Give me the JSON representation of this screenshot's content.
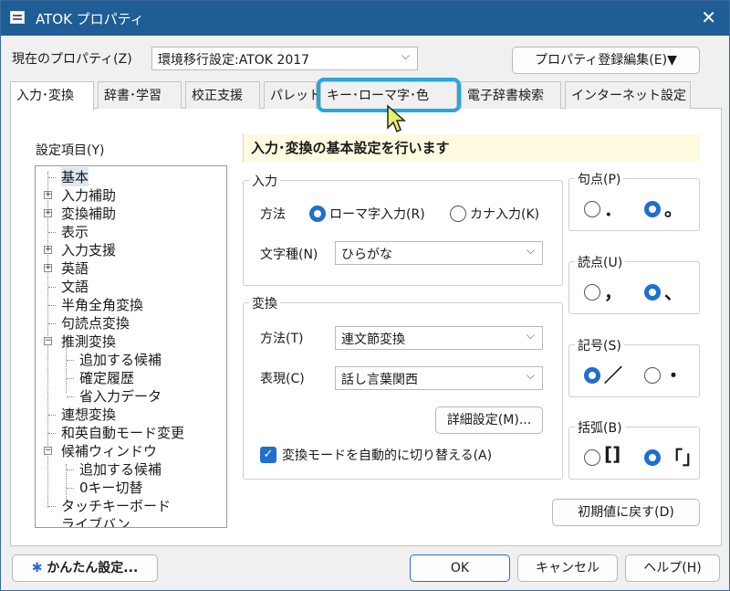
{
  "window": {
    "title": "ATOK プロパティ",
    "close": "✕"
  },
  "current": {
    "label": "現在のプロパティ(Z)",
    "value": "環境移行設定:ATOK 2017",
    "edit_btn": "プロパティ登録編集(E)▼"
  },
  "tabs": [
    {
      "label": "入力･変換",
      "active": true
    },
    {
      "label": "辞書･学習"
    },
    {
      "label": "校正支援"
    },
    {
      "label": "パレット"
    },
    {
      "label": "キー･ローマ字･色",
      "highlighted": true
    },
    {
      "label": "電子辞書検索"
    },
    {
      "label": "インターネット設定"
    }
  ],
  "tree": {
    "label": "設定項目(Y)",
    "items": [
      {
        "text": "基本",
        "level": 0
      },
      {
        "text": "入力補助",
        "level": 0,
        "expander": "+"
      },
      {
        "text": "変換補助",
        "level": 0,
        "expander": "+"
      },
      {
        "text": "表示",
        "level": 0
      },
      {
        "text": "入力支援",
        "level": 0,
        "expander": "+"
      },
      {
        "text": "英語",
        "level": 0,
        "expander": "+"
      },
      {
        "text": "文語",
        "level": 0
      },
      {
        "text": "半角全角変換",
        "level": 0
      },
      {
        "text": "句読点変換",
        "level": 0
      },
      {
        "text": "推測変換",
        "level": 0,
        "expander": "−"
      },
      {
        "text": "追加する候補",
        "level": 1
      },
      {
        "text": "確定履歴",
        "level": 1
      },
      {
        "text": "省入力データ",
        "level": 1
      },
      {
        "text": "連想変換",
        "level": 0
      },
      {
        "text": "和英自動モード変更",
        "level": 0
      },
      {
        "text": "候補ウィンドウ",
        "level": 0,
        "expander": "−"
      },
      {
        "text": "追加する候補",
        "level": 1
      },
      {
        "text": "0キー切替",
        "level": 1
      },
      {
        "text": "タッチキーボード",
        "level": 0
      },
      {
        "text": "ライブバン...",
        "level": 0
      }
    ]
  },
  "banner": "入力･変換の基本設定を行います",
  "input_group": {
    "title": "入力",
    "method_label": "方法",
    "romaji": "ローマ字入力(R)",
    "kana": "カナ入力(K)",
    "chartype_label": "文字種(N)",
    "chartype_value": "ひらがな"
  },
  "convert_group": {
    "title": "変換",
    "method_label": "方法(T)",
    "method_value": "連文節変換",
    "expr_label": "表現(C)",
    "expr_value": "話し言葉関西",
    "detail_btn": "詳細設定(M)...",
    "auto_switch": "変換モードを自動的に切り替える(A)"
  },
  "kuten": {
    "title": "句点(P)",
    "opt1": "．",
    "opt2": "。"
  },
  "touten": {
    "title": "読点(U)",
    "opt1": "，",
    "opt2": "、"
  },
  "kigou": {
    "title": "記号(S)",
    "opt1": "／",
    "opt2": "・"
  },
  "kakko": {
    "title": "括弧(B)",
    "opt1": "[]",
    "opt2": "「」"
  },
  "reset_btn": "初期値に戻す(D)",
  "footer": {
    "easy_btn": "かんたん設定...",
    "ok": "OK",
    "cancel": "キャンセル",
    "help": "ヘルプ(H)"
  },
  "colors": {
    "titlebar": "#1f5d96",
    "accent": "#1f6fd1",
    "highlight": "#29a6dc",
    "banner": "#fffbe0"
  }
}
